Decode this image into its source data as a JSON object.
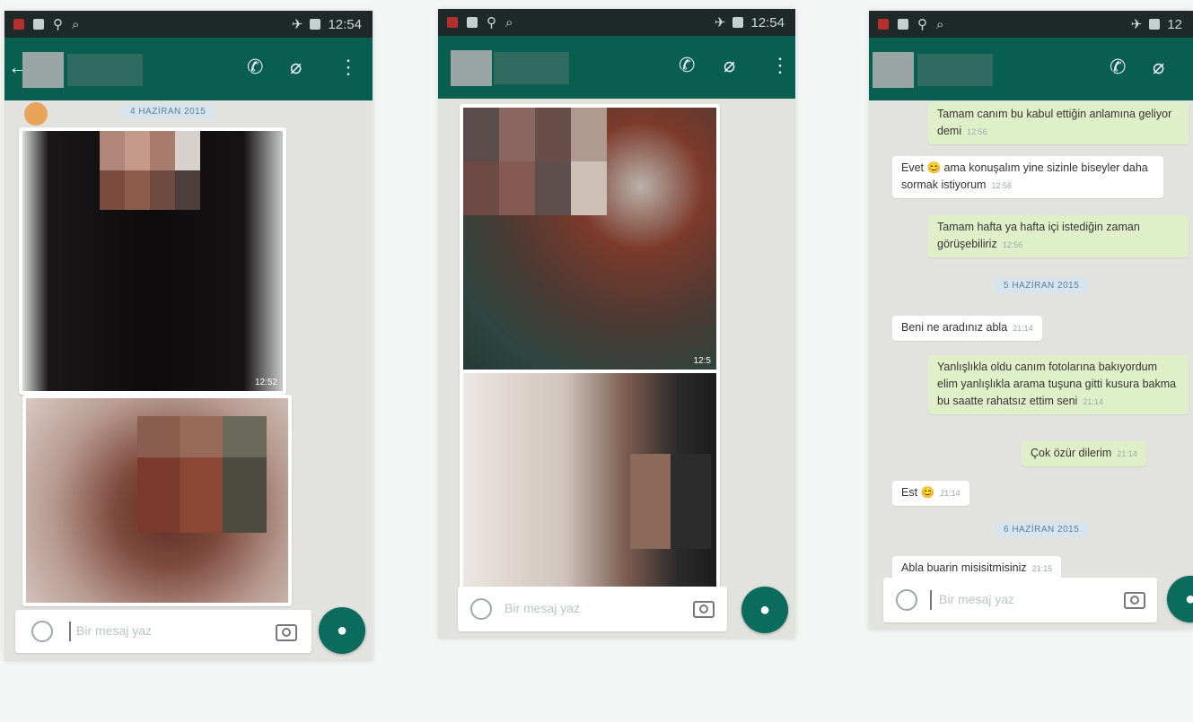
{
  "phone1": {
    "status_time": "12:54",
    "date_label": "4 HAZİRAN 2015",
    "photo1_time": "12:52",
    "input_placeholder": "Bir mesaj yaz"
  },
  "phone2": {
    "status_time": "12:54",
    "photo1_time": "12:5",
    "input_placeholder": "Bir mesaj yaz"
  },
  "phone3": {
    "status_time": "12",
    "messages": [
      {
        "dir": "out",
        "text": "Tamam canım bu kabul ettiğin anlamına geliyor demi",
        "time": "12:56"
      },
      {
        "dir": "in",
        "text": "Evet 😊 ama konuşalım yine sizinle biseyler daha sormak istiyorum",
        "time": "12:56"
      },
      {
        "dir": "out",
        "text": "Tamam hafta ya hafta içi istediğin zaman görüşebiliriz",
        "time": "12:56"
      },
      {
        "dir": "in",
        "text": "Beni ne aradınız abla",
        "time": "21:14"
      },
      {
        "dir": "out",
        "text": "Yanlışlıkla oldu canım fotolarına bakıyordum elim yanlışlıkla arama tuşuna gitti kusura bakma bu saatte rahatsız ettim seni",
        "time": "21:14"
      },
      {
        "dir": "out",
        "text": "Çok özür dilerim",
        "time": "21:14"
      },
      {
        "dir": "in",
        "text": "Est 😊",
        "time": "21:14"
      },
      {
        "dir": "in",
        "text": "Abla buarin misisitmisiniz",
        "time": "21:15"
      }
    ],
    "date_label_1": "5 HAZİRAN 2015",
    "date_label_2": "6 HAZİRAN 2015",
    "input_placeholder": "Bir mesaj yaz"
  },
  "icons": {
    "call": "phone-icon",
    "attach": "paperclip-icon",
    "menu": "more-vert-icon",
    "mic": "mic-icon",
    "camera": "camera-icon",
    "emoji": "emoji-icon"
  },
  "colors": {
    "appbar": "#085e4f",
    "outgoing_bubble": "#dff0c9",
    "mic_button": "#0b6b5c"
  }
}
